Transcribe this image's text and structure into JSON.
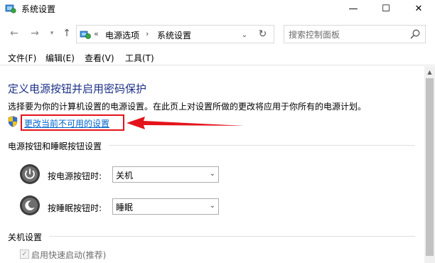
{
  "window": {
    "title": "系统设置",
    "minimize_glyph": "—",
    "maximize_glyph": "☐",
    "close_glyph": "✕"
  },
  "nav": {
    "back_glyph": "←",
    "forward_glyph": "→",
    "dropdown_glyph": "▾",
    "up_glyph": "↑",
    "address_sep": "«",
    "breadcrumb": [
      "电源选项",
      "系统设置"
    ],
    "breadcrumb_sep": "›",
    "address_dropdown_glyph": "⌄",
    "refresh_glyph": "↻",
    "search_placeholder": "搜索控制面板"
  },
  "menu": {
    "items": [
      "文件(F)",
      "编辑(E)",
      "查看(V)",
      "工具(T)"
    ]
  },
  "main": {
    "title": "定义电源按钮并启用密码保护",
    "description": "选择要为你的计算机设置的电源设置。在此页上对设置所做的更改将应用于你所有的电源计划。",
    "change_link": "更改当前不可用的设置",
    "power_section": {
      "heading": "电源按钮和睡眠按钮设置",
      "rows": [
        {
          "label": "按电源按钮时:",
          "value": "关机"
        },
        {
          "label": "按睡眠按钮时:",
          "value": "睡眠"
        }
      ]
    },
    "shutdown_section": {
      "heading": "关机设置",
      "fast_startup": {
        "label": "启用快速启动(推荐)",
        "checked": true,
        "check_glyph": "✓"
      }
    }
  },
  "colors": {
    "title_blue": "#1e3287",
    "link_blue": "#0066cc",
    "highlight_red": "#e4131b"
  },
  "scrollbar": {
    "up_glyph": "▲"
  },
  "select_arrow_glyph": "⌄"
}
